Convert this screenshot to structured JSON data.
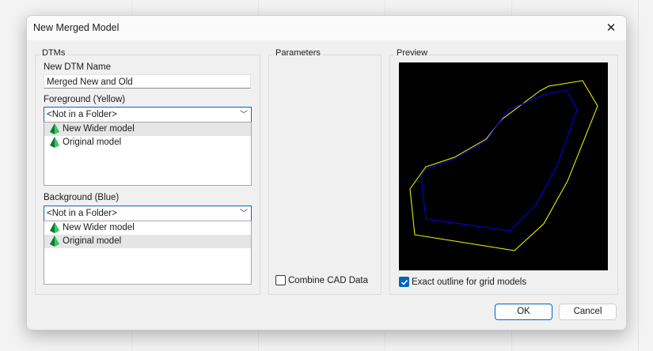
{
  "dialog": {
    "title": "New Merged Model",
    "close_icon": "close-icon"
  },
  "dtms": {
    "group_label": "DTMs",
    "name_label": "New DTM Name",
    "name_value": "Merged New and Old",
    "foreground_label": "Foreground (Yellow)",
    "foreground_folder": "<Not in a Folder>",
    "foreground_items": [
      {
        "label": "New Wider model",
        "selected": true,
        "icon": "dtm-model-icon"
      },
      {
        "label": "Original model",
        "selected": false,
        "icon": "dtm-model-icon"
      }
    ],
    "background_label": "Background (Blue)",
    "background_folder": "<Not in a Folder>",
    "background_items": [
      {
        "label": "New Wider model",
        "selected": false,
        "icon": "dtm-model-icon"
      },
      {
        "label": "Original model",
        "selected": true,
        "icon": "dtm-model-icon"
      }
    ]
  },
  "parameters": {
    "group_label": "Parameters",
    "combine_cad_label": "Combine CAD Data",
    "combine_cad_checked": false
  },
  "preview": {
    "group_label": "Preview",
    "exact_outline_label": "Exact outline for grid models",
    "exact_outline_checked": true,
    "foreground_color": "#ffff00",
    "background_color": "#0000ff"
  },
  "buttons": {
    "ok": "OK",
    "cancel": "Cancel"
  },
  "colors": {
    "accent": "#0067c0",
    "icon_green": "#1aa84a"
  }
}
